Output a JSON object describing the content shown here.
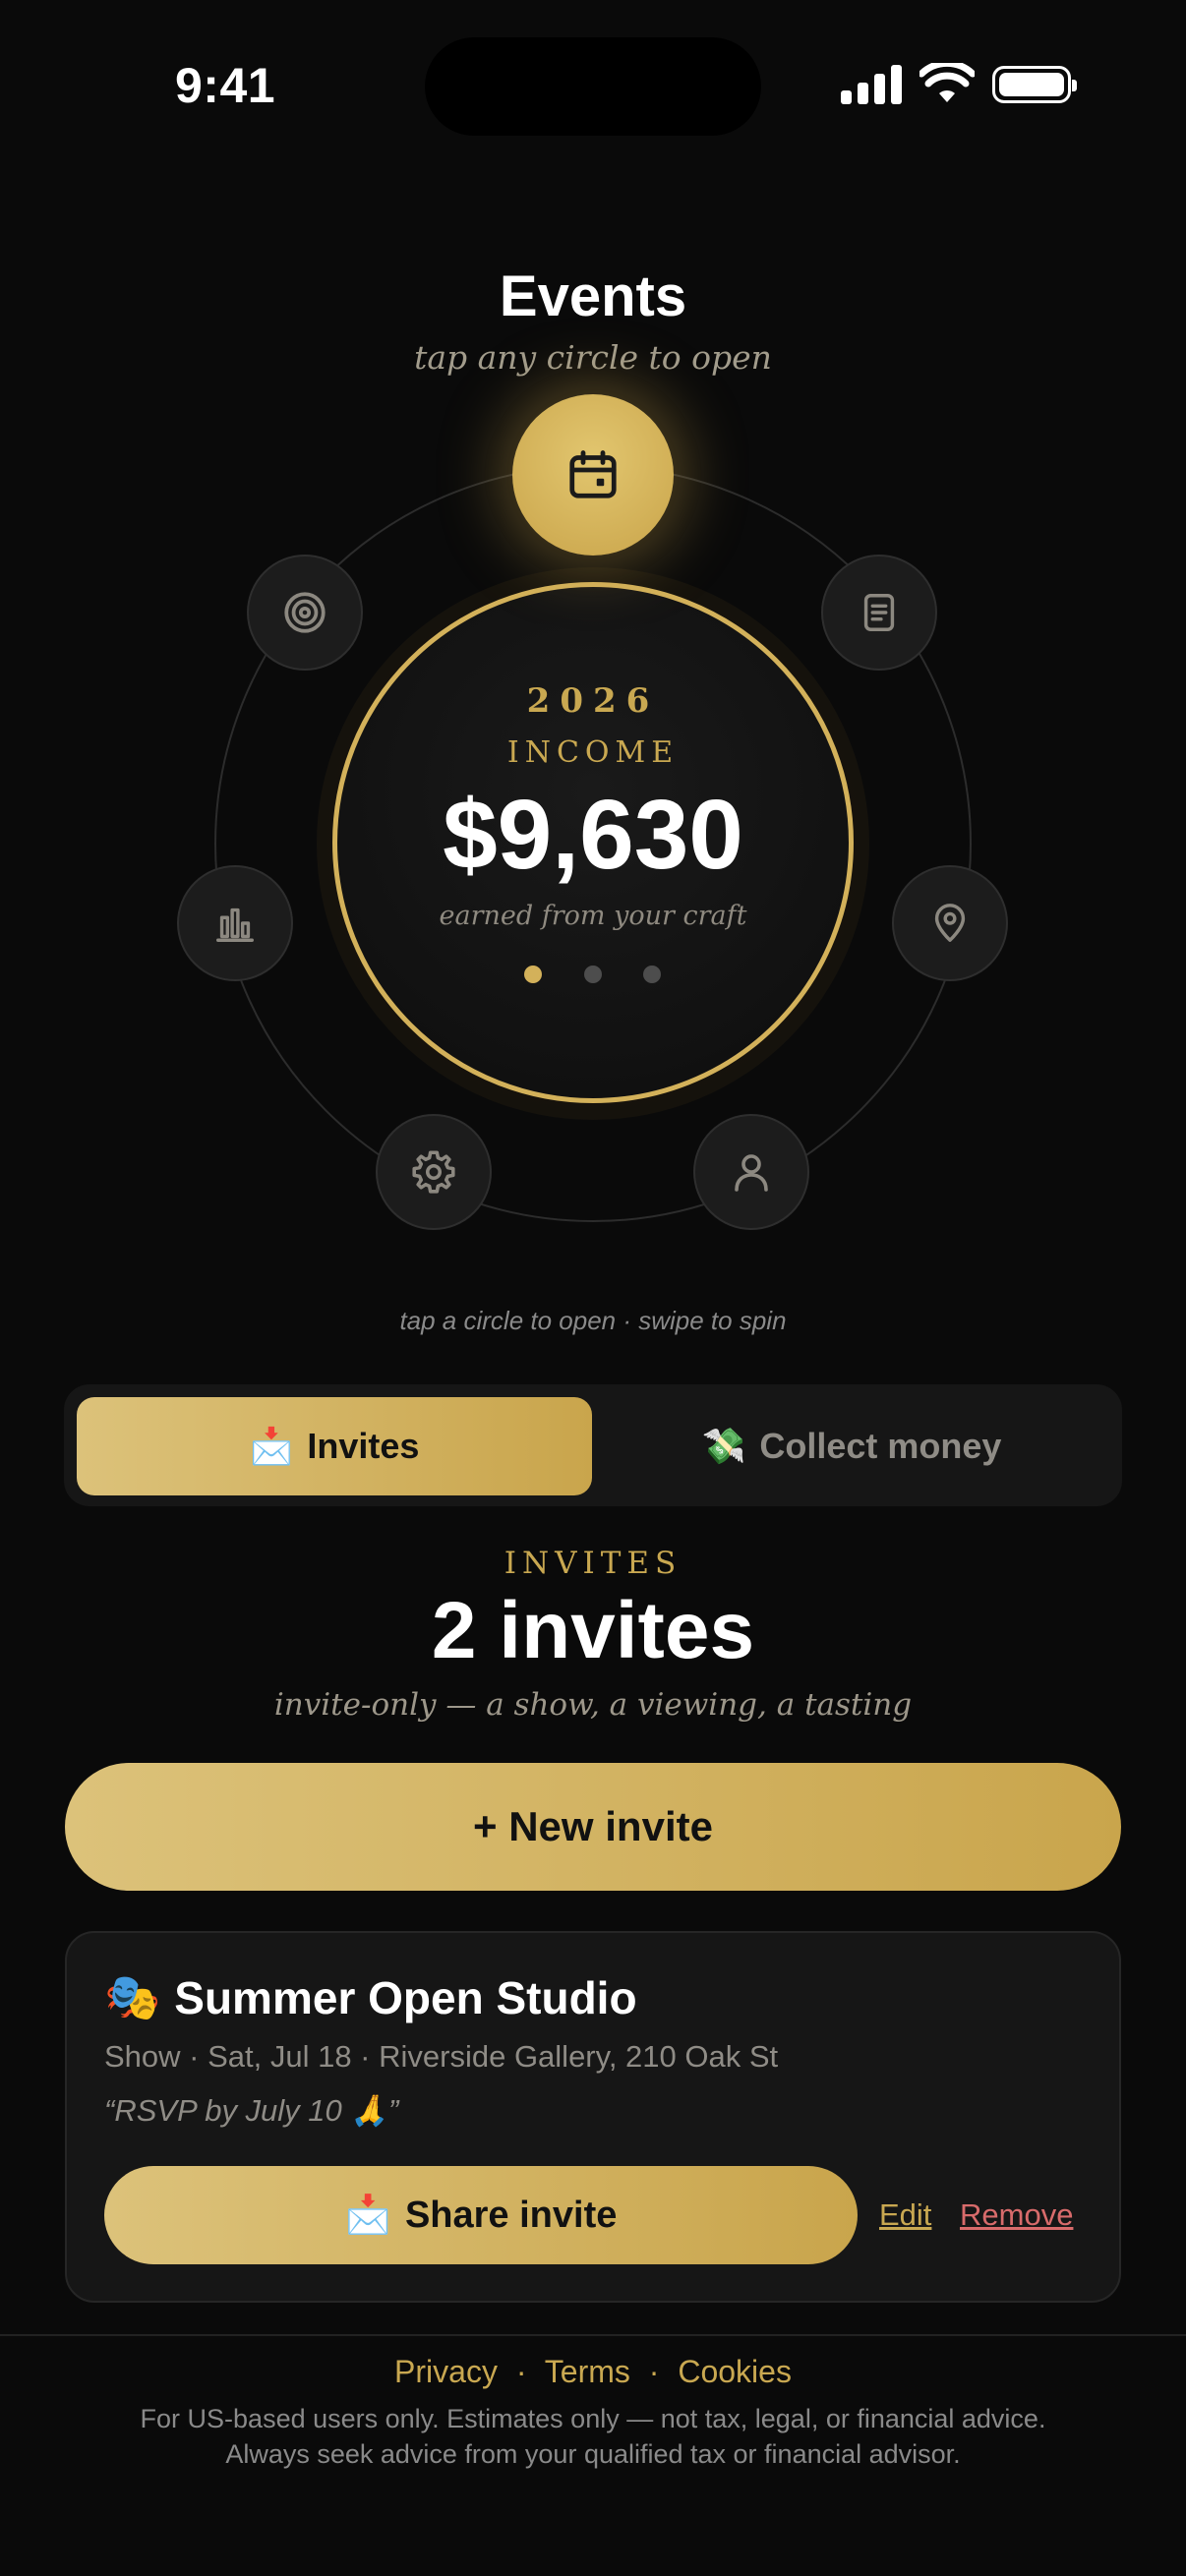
{
  "status_bar": {
    "time": "9:41"
  },
  "header": {
    "title": "Events",
    "subtitle": "tap any circle to open"
  },
  "wheel": {
    "year": "2026",
    "label": "INCOME",
    "amount": "$9,630",
    "caption": "earned from your craft",
    "page_dots": 3,
    "active_dot": 0,
    "nodes": [
      {
        "icon": "calendar-icon",
        "active": true
      },
      {
        "icon": "document-icon"
      },
      {
        "icon": "location-pin-icon"
      },
      {
        "icon": "person-icon"
      },
      {
        "icon": "gear-icon"
      },
      {
        "icon": "bar-chart-icon"
      },
      {
        "icon": "target-icon"
      }
    ],
    "hint": "tap a circle to open · swipe to spin"
  },
  "segmented": {
    "invites": {
      "emoji": "📩",
      "label": "Invites"
    },
    "collect": {
      "emoji": "💸",
      "label": "Collect money"
    }
  },
  "section": {
    "kicker": "INVITES",
    "title": "2 invites",
    "subtitle": "invite-only — a show, a viewing, a tasting",
    "new_button": "+ New invite"
  },
  "invite_card": {
    "emoji": "🎭",
    "title": "Summer Open Studio",
    "meta": "Show · Sat, Jul 18 · Riverside Gallery, 210 Oak St",
    "note": "“RSVP by July 10 🙏”",
    "share_emoji": "📩",
    "share_label": "Share invite",
    "edit_label": "Edit",
    "remove_label": "Remove"
  },
  "footer": {
    "privacy": "Privacy",
    "terms": "Terms",
    "cookies": "Cookies",
    "separator": "·",
    "disclaimer_line1": "For US-based users only. Estimates only — not tax, legal, or financial advice.",
    "disclaimer_line2": "Always seek advice from your qualified tax or financial advisor."
  },
  "colors": {
    "accent": "#d3b15a",
    "background": "#0a0a0a",
    "danger": "#d86b6b"
  }
}
